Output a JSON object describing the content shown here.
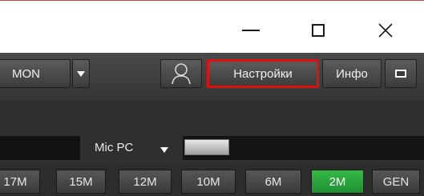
{
  "window": {
    "controls": [
      "minimize",
      "maximize",
      "close"
    ]
  },
  "toolbar": {
    "mode_value": "MON",
    "settings_label": "Настройки",
    "info_label": "Инфо",
    "user_icon": "user-icon",
    "window_icon": "window-icon"
  },
  "audio": {
    "mic_label": "Mic PC"
  },
  "bands": [
    {
      "label": "17M",
      "active": false
    },
    {
      "label": "15M",
      "active": false
    },
    {
      "label": "12M",
      "active": false
    },
    {
      "label": "10M",
      "active": false
    },
    {
      "label": "6M",
      "active": false
    },
    {
      "label": "2M",
      "active": true
    },
    {
      "label": "GEN",
      "active": false
    }
  ],
  "colors": {
    "highlight_border": "#e01010",
    "active_band": "#2aa83c"
  }
}
